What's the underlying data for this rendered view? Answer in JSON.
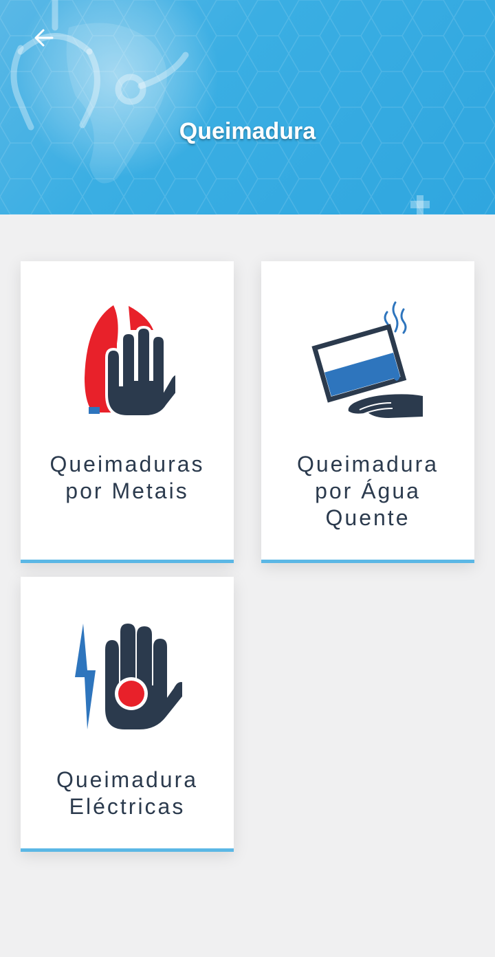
{
  "header": {
    "title": "Queimadura",
    "back_icon": "arrow-left-icon",
    "background_color": "#3aaee3"
  },
  "cards": [
    {
      "label": "Queimaduras por Metais",
      "icon": "hot-iron-hand-icon"
    },
    {
      "label": "Queimadura por Água Quente",
      "icon": "hot-water-hand-icon"
    },
    {
      "label": "Queimadura Eléctricas",
      "icon": "electric-hand-icon"
    }
  ],
  "colors": {
    "accent": "#5bb7e5",
    "text": "#2b3a4d",
    "icon_dark": "#2b3a4d",
    "icon_red": "#e8212a",
    "icon_blue": "#2e75bd",
    "background": "#f0f0f1"
  }
}
